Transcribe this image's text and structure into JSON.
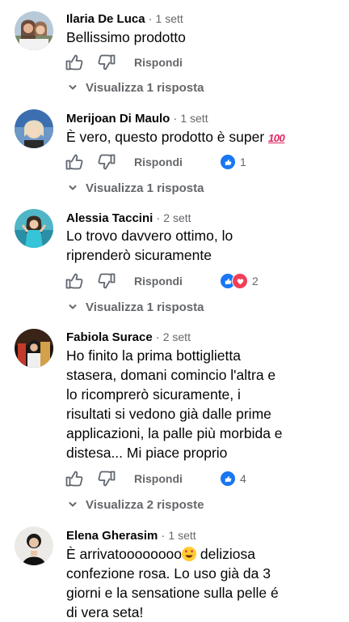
{
  "comments": [
    {
      "name": "Ilaria De Luca",
      "time": "1 sett",
      "text": "Bellissimo prodotto",
      "reply_label": "Rispondi",
      "reactions": "",
      "view_replies": "Visualizza 1 risposta"
    },
    {
      "name": "Merijoan Di Maulo",
      "time": "1 sett",
      "text": "È vero, questo prodotto è super",
      "emoji": "hundred-points",
      "reply_label": "Rispondi",
      "reactions": "1",
      "view_replies": "Visualizza 1 risposta"
    },
    {
      "name": "Alessia Taccini",
      "time": "2 sett",
      "text_lines": [
        "Lo trovo davvero ottimo, lo",
        "riprenderò sicuramente"
      ],
      "reply_label": "Rispondi",
      "reactions": "2",
      "view_replies": "Visualizza 1 risposta"
    },
    {
      "name": "Fabiola Surace",
      "time": "2 sett",
      "text_lines": [
        "Ho finito la prima bottiglietta",
        "stasera, domani comincio l'altra e",
        "lo ricomprerò sicuramente, i",
        "risultati si vedono già dalle prime",
        "applicazioni, la palle più morbida e",
        "distesa... Mi piace proprio"
      ],
      "reply_label": "Rispondi",
      "reactions": "4",
      "view_replies": "Visualizza 2 risposte"
    },
    {
      "name": "Elena Gherasim",
      "time": "1 sett",
      "text_first": "È arrivatoooooooo",
      "emoji": "heart-eyes",
      "text_after": " deliziosa",
      "text_lines": [
        "confezione rosa. Lo uso già da 3",
        "giorni e la sensatione sulla pelle é",
        "di vera seta!"
      ]
    }
  ],
  "colors": {
    "reaction_blue": "#1877f2",
    "reaction_red": "#f33e58",
    "meta_gray": "#65676b"
  }
}
